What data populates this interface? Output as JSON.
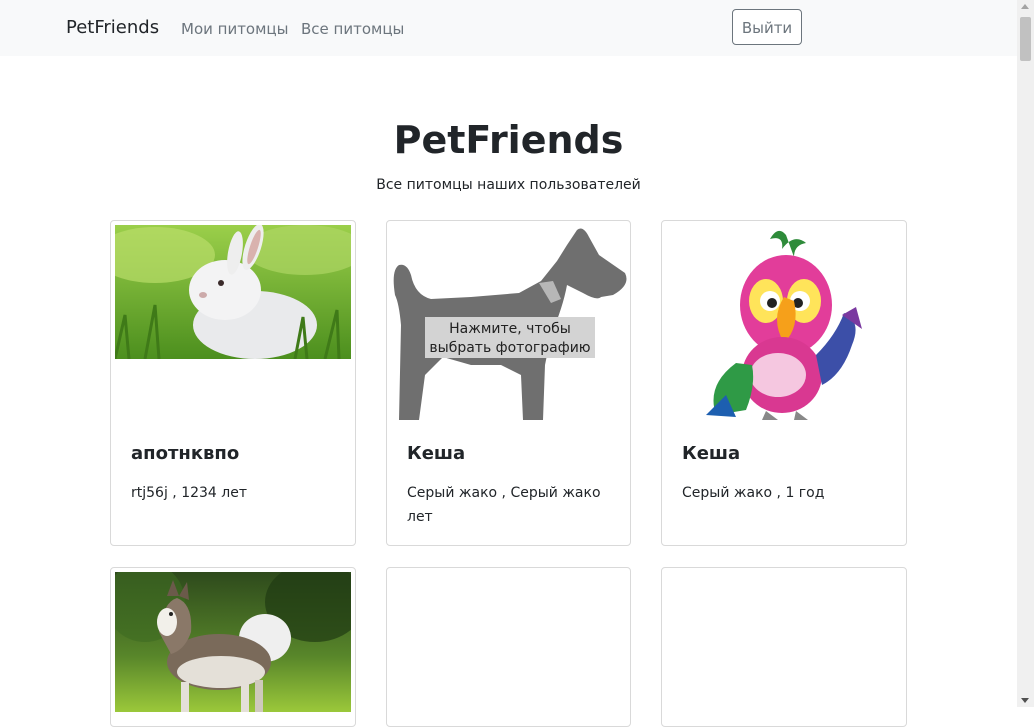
{
  "navbar": {
    "brand": "PetFriends",
    "links": [
      "Мои питомцы",
      "Все питомцы"
    ],
    "logout_label": "Выйти"
  },
  "header": {
    "title": "PetFriends",
    "subtitle": "Все питомцы наших пользователей"
  },
  "cards": [
    {
      "name": "апотнквпо",
      "info": "rtj56j , 1234 лет",
      "image": "rabbit-photo"
    },
    {
      "name": "Кеша",
      "info": "Серый жако , Серый жако лет",
      "image": "dog-placeholder",
      "placeholder_text": "Нажмите, чтобы выбрать фотографию"
    },
    {
      "name": "Кеша",
      "info": "Серый жако , 1 год",
      "image": "parrot-cartoon"
    },
    {
      "name": "",
      "info": "",
      "image": "husky-photo"
    },
    {
      "name": "",
      "info": "",
      "image": ""
    },
    {
      "name": "",
      "info": "",
      "image": ""
    }
  ],
  "colors": {
    "navbar_bg": "#f8f9fa",
    "muted_text": "#6c757d",
    "card_border": "#d9d9d9"
  }
}
